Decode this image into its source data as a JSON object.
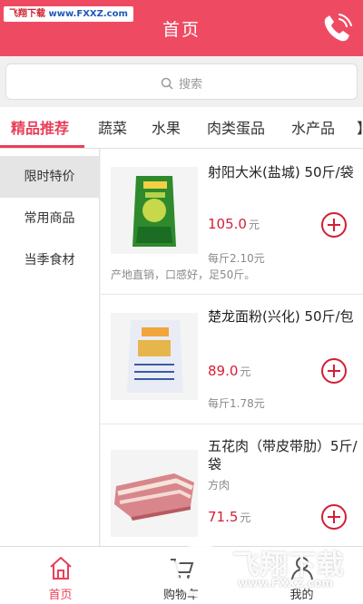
{
  "watermark": {
    "part1": "飞翔下载",
    "part2": "www.FXXZ.com"
  },
  "header": {
    "title": "首页",
    "phone_icon": "phone-icon"
  },
  "search": {
    "placeholder": "搜索",
    "icon": "search-icon"
  },
  "tabs": [
    {
      "label": "精品推荐",
      "active": true
    },
    {
      "label": "蔬菜"
    },
    {
      "label": "水果"
    },
    {
      "label": "肉类蛋品"
    },
    {
      "label": "水产品"
    },
    {
      "label": "】"
    }
  ],
  "sidebar": {
    "items": [
      {
        "label": "限时特价",
        "active": true
      },
      {
        "label": "常用商品"
      },
      {
        "label": "当季食材"
      }
    ]
  },
  "products": [
    {
      "name": "射阳大米(盐城) 50斤/袋",
      "price": "105.0",
      "unit": "元",
      "per_unit": "每斤2.10元",
      "desc": "产地直销，口感好，足50斤。"
    },
    {
      "name": "楚龙面粉(兴化) 50斤/包",
      "price": "89.0",
      "unit": "元",
      "per_unit": "每斤1.78元"
    },
    {
      "name": "五花肉（带皮带肋）5斤/袋",
      "subname": "方肉",
      "price": "71.5",
      "unit": "元"
    }
  ],
  "bottom_nav": [
    {
      "label": "首页",
      "icon": "home-icon",
      "active": true
    },
    {
      "label": "购物车",
      "icon": "cart-icon"
    },
    {
      "label": "我的",
      "icon": "user-icon"
    }
  ],
  "overlay": {
    "title": "飞翔下载",
    "url": "www.FXXZ.com"
  },
  "colors": {
    "brand": "#ee4b63",
    "accent": "#e8405a",
    "price": "#d41e35"
  }
}
